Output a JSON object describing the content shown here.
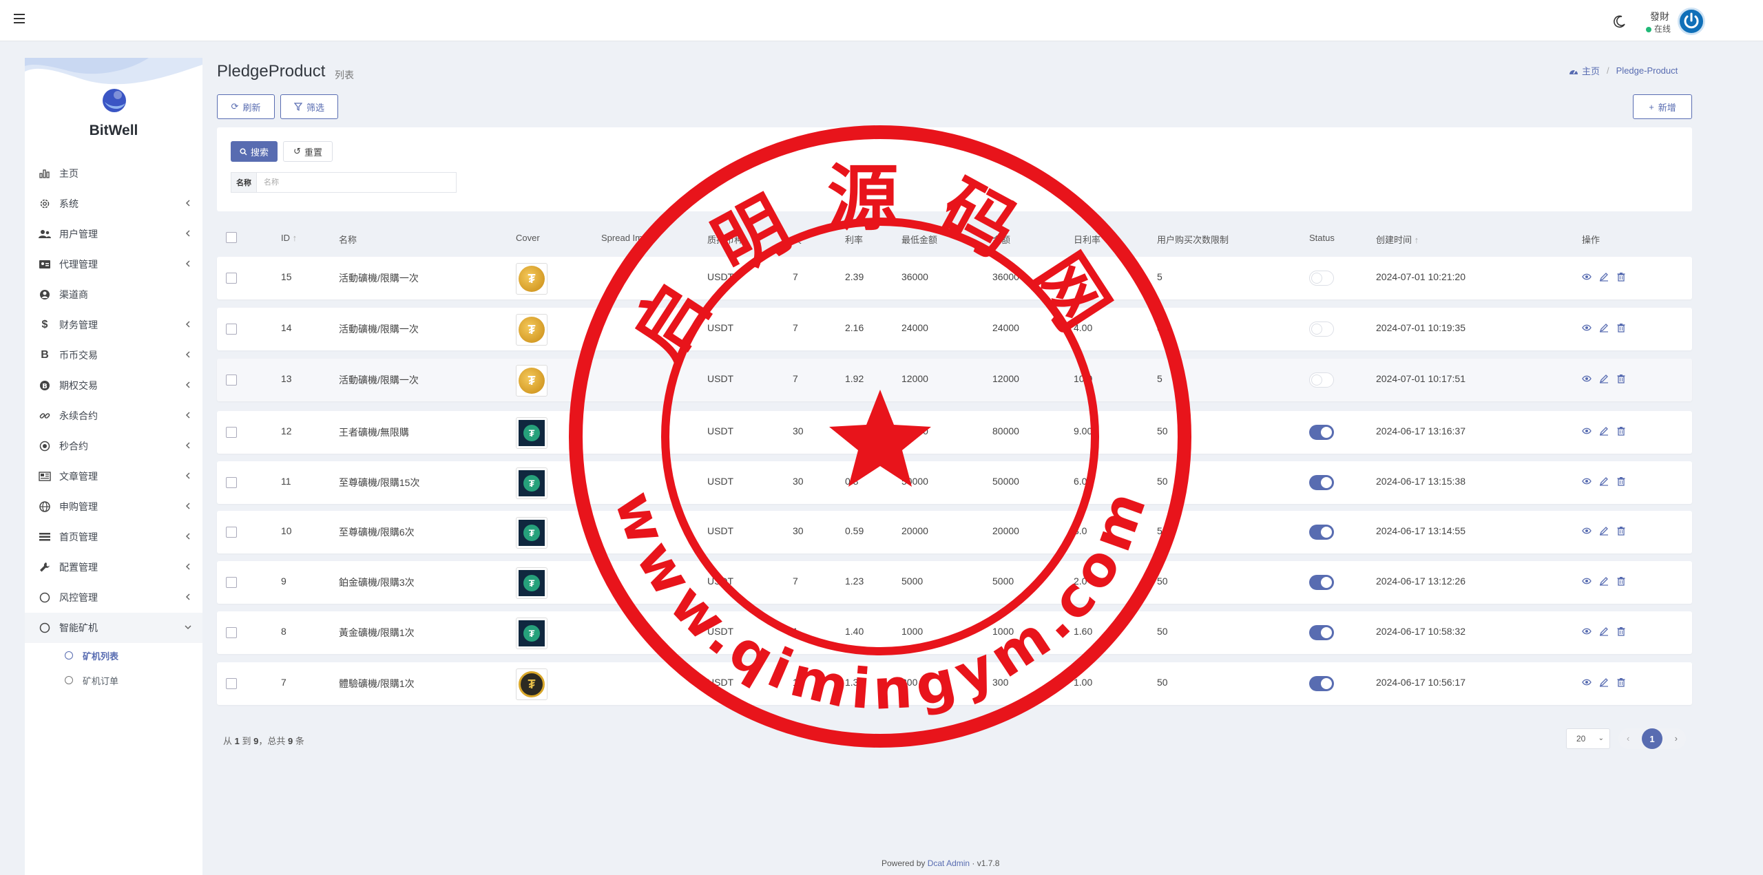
{
  "navbar": {
    "user_name": "發財",
    "user_status": "在线"
  },
  "sidebar": {
    "brand": "BitWell",
    "items": [
      {
        "label": "主页",
        "icon": "bar-chart-icon",
        "chevron": false
      },
      {
        "label": "系统",
        "icon": "gear-icon",
        "chevron": true
      },
      {
        "label": "用户管理",
        "icon": "users-icon",
        "chevron": true
      },
      {
        "label": "代理管理",
        "icon": "id-card-icon",
        "chevron": true
      },
      {
        "label": "渠道商",
        "icon": "user-circle-icon",
        "chevron": false
      },
      {
        "label": "财务管理",
        "icon": "dollar-icon",
        "chevron": true
      },
      {
        "label": "币币交易",
        "icon": "bitcoin-icon",
        "chevron": true
      },
      {
        "label": "期权交易",
        "icon": "bitcoin-circle-icon",
        "chevron": true
      },
      {
        "label": "永续合约",
        "icon": "link-icon",
        "chevron": true
      },
      {
        "label": "秒合约",
        "icon": "dot-circle-icon",
        "chevron": true
      },
      {
        "label": "文章管理",
        "icon": "newspaper-icon",
        "chevron": true
      },
      {
        "label": "申购管理",
        "icon": "globe-icon",
        "chevron": true
      },
      {
        "label": "首页管理",
        "icon": "list-icon",
        "chevron": true
      },
      {
        "label": "配置管理",
        "icon": "wrench-icon",
        "chevron": true
      },
      {
        "label": "风控管理",
        "icon": "circle-icon",
        "chevron": true
      },
      {
        "label": "智能矿机",
        "icon": "circle-icon",
        "chevron": true,
        "open": true
      }
    ],
    "sub_items": [
      {
        "label": "矿机列表",
        "active": true
      },
      {
        "label": "矿机订单",
        "active": false
      }
    ]
  },
  "page": {
    "title": "PledgeProduct",
    "subtitle": "列表",
    "breadcrumb_home": "主页",
    "breadcrumb_current": "Pledge-Product"
  },
  "toolbar": {
    "refresh_label": "刷新",
    "filter_label": "筛选",
    "add_label": "新增"
  },
  "filter": {
    "search_label": "搜索",
    "reset_label": "重置",
    "name_label": "名称",
    "name_placeholder": "名称"
  },
  "table": {
    "headers": {
      "id": "ID",
      "name": "名称",
      "cover": "Cover",
      "spread": "Spread Im",
      "currency": "质押币种",
      "days": "天",
      "rate": "利率",
      "min": "最低金额",
      "max": "金额",
      "daily": "日利率",
      "limit": "用户购买次数限制",
      "status": "Status",
      "created": "创建时间",
      "actions": "操作"
    },
    "rows": [
      {
        "id": "15",
        "name": "活動礦機/限購一次",
        "cover": "gold",
        "currency": "USDT",
        "days": "7",
        "rate": "2.39",
        "min": "36000",
        "max": "36000",
        "daily": "",
        "limit": "5",
        "status": false,
        "created": "2024-07-01 10:21:20"
      },
      {
        "id": "14",
        "name": "活動礦機/限購一次",
        "cover": "gold",
        "currency": "USDT",
        "days": "7",
        "rate": "2.16",
        "min": "24000",
        "max": "24000",
        "daily": "4.00",
        "limit": "5",
        "status": false,
        "created": "2024-07-01 10:19:35"
      },
      {
        "id": "13",
        "name": "活動礦機/限購一次",
        "cover": "gold",
        "currency": "USDT",
        "days": "7",
        "rate": "1.92",
        "min": "12000",
        "max": "12000",
        "daily": "10.0",
        "limit": "5",
        "status": false,
        "created": "2024-07-01 10:17:51"
      },
      {
        "id": "12",
        "name": "王者礦機/無限購",
        "cover": "navy",
        "currency": "USDT",
        "days": "30",
        "rate": "",
        "min": "80000",
        "max": "80000",
        "daily": "9.00",
        "limit": "50",
        "status": true,
        "created": "2024-06-17 13:16:37"
      },
      {
        "id": "11",
        "name": "至尊礦機/限購15次",
        "cover": "navy",
        "currency": "USDT",
        "days": "30",
        "rate": "0.8",
        "min": "50000",
        "max": "50000",
        "daily": "6.00",
        "limit": "50",
        "status": true,
        "created": "2024-06-17 13:15:38"
      },
      {
        "id": "10",
        "name": "至尊礦機/限購6次",
        "cover": "navy",
        "currency": "USDT",
        "days": "30",
        "rate": "0.59",
        "min": "20000",
        "max": "20000",
        "daily": "3.0",
        "limit": "50",
        "status": true,
        "created": "2024-06-17 13:14:55"
      },
      {
        "id": "9",
        "name": "鉑金礦機/限購3次",
        "cover": "navy",
        "currency": "USDT",
        "days": "7",
        "rate": "1.23",
        "min": "5000",
        "max": "5000",
        "daily": "2.0",
        "limit": "50",
        "status": true,
        "created": "2024-06-17 13:12:26"
      },
      {
        "id": "8",
        "name": "黃金礦機/限購1次",
        "cover": "navy",
        "currency": "USDT",
        "days": "1",
        "rate": "1.40",
        "min": "1000",
        "max": "1000",
        "daily": "1.60",
        "limit": "50",
        "status": true,
        "created": "2024-06-17 10:58:32"
      },
      {
        "id": "7",
        "name": "體驗礦機/限購1次",
        "cover": "dark",
        "currency": "USDT",
        "days": "1",
        "rate": "1.36",
        "min": "300",
        "max": "300",
        "daily": "1.00",
        "limit": "50",
        "status": true,
        "created": "2024-06-17 10:56:17"
      }
    ]
  },
  "pagination": {
    "prefix": "从",
    "from": "1",
    "to_word": "到",
    "to": "9",
    "total_word": "，总共",
    "total": "9",
    "suffix": "条",
    "per_page": "20",
    "current_page": "1"
  },
  "footer": {
    "powered_by": "Powered by",
    "link": "Dcat Admin",
    "version": "· v1.7.8"
  },
  "stamp": {
    "top_text": "启明源码网",
    "bottom_text": "www.qimingym.com",
    "color": "#e8141b"
  },
  "colors": {
    "accent": "#586cb1",
    "online": "#21b978"
  }
}
